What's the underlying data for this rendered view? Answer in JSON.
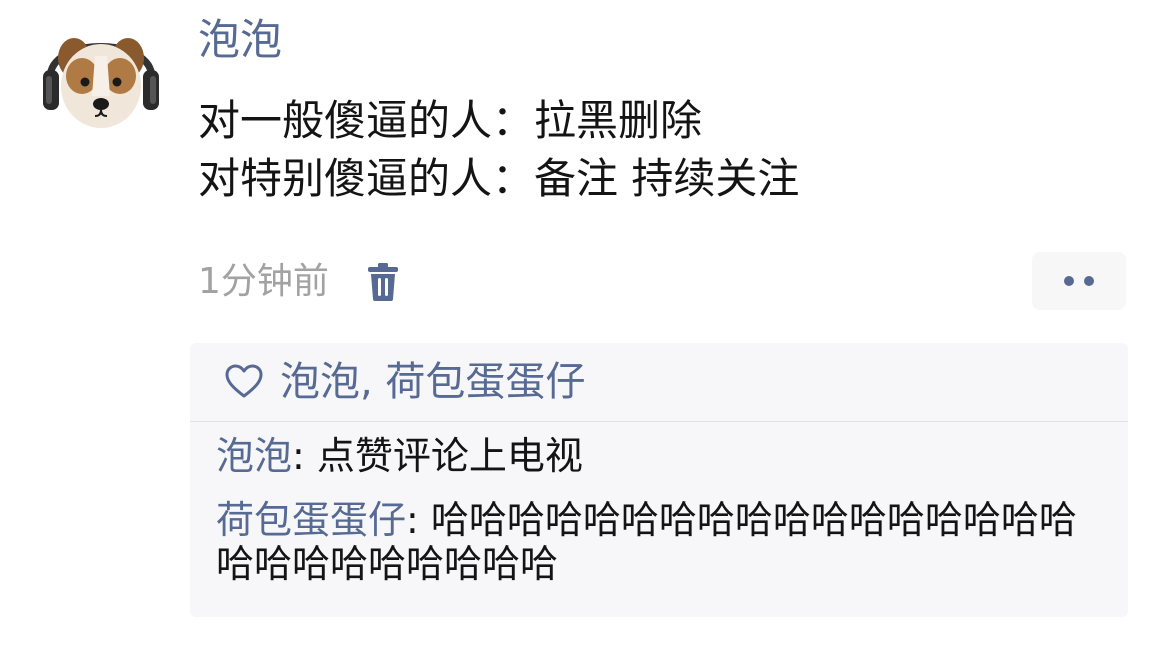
{
  "post": {
    "author": "泡泡",
    "lines": [
      "对一般傻逼的人：拉黑删除",
      "对特别傻逼的人：备注 持续关注"
    ],
    "timestamp": "1分钟前",
    "delete_icon": "trash-icon",
    "more_icon": "more-dots-icon",
    "avatar_icon": "dog-with-headphones-avatar"
  },
  "likes": {
    "icon": "heart-outline-icon",
    "names": "泡泡, 荷包蛋蛋仔"
  },
  "comments": [
    {
      "author": "泡泡",
      "separator": ": ",
      "text": "点赞评论上电视"
    },
    {
      "author": "荷包蛋蛋仔",
      "separator": ": ",
      "text": "哈哈哈哈哈哈哈哈哈哈哈哈哈哈哈哈哈哈哈哈哈哈哈哈哈哈"
    }
  ],
  "colors": {
    "link": "#566a94",
    "text": "#141414",
    "meta": "#a2a2a2",
    "panel_bg": "#f7f7f9"
  }
}
